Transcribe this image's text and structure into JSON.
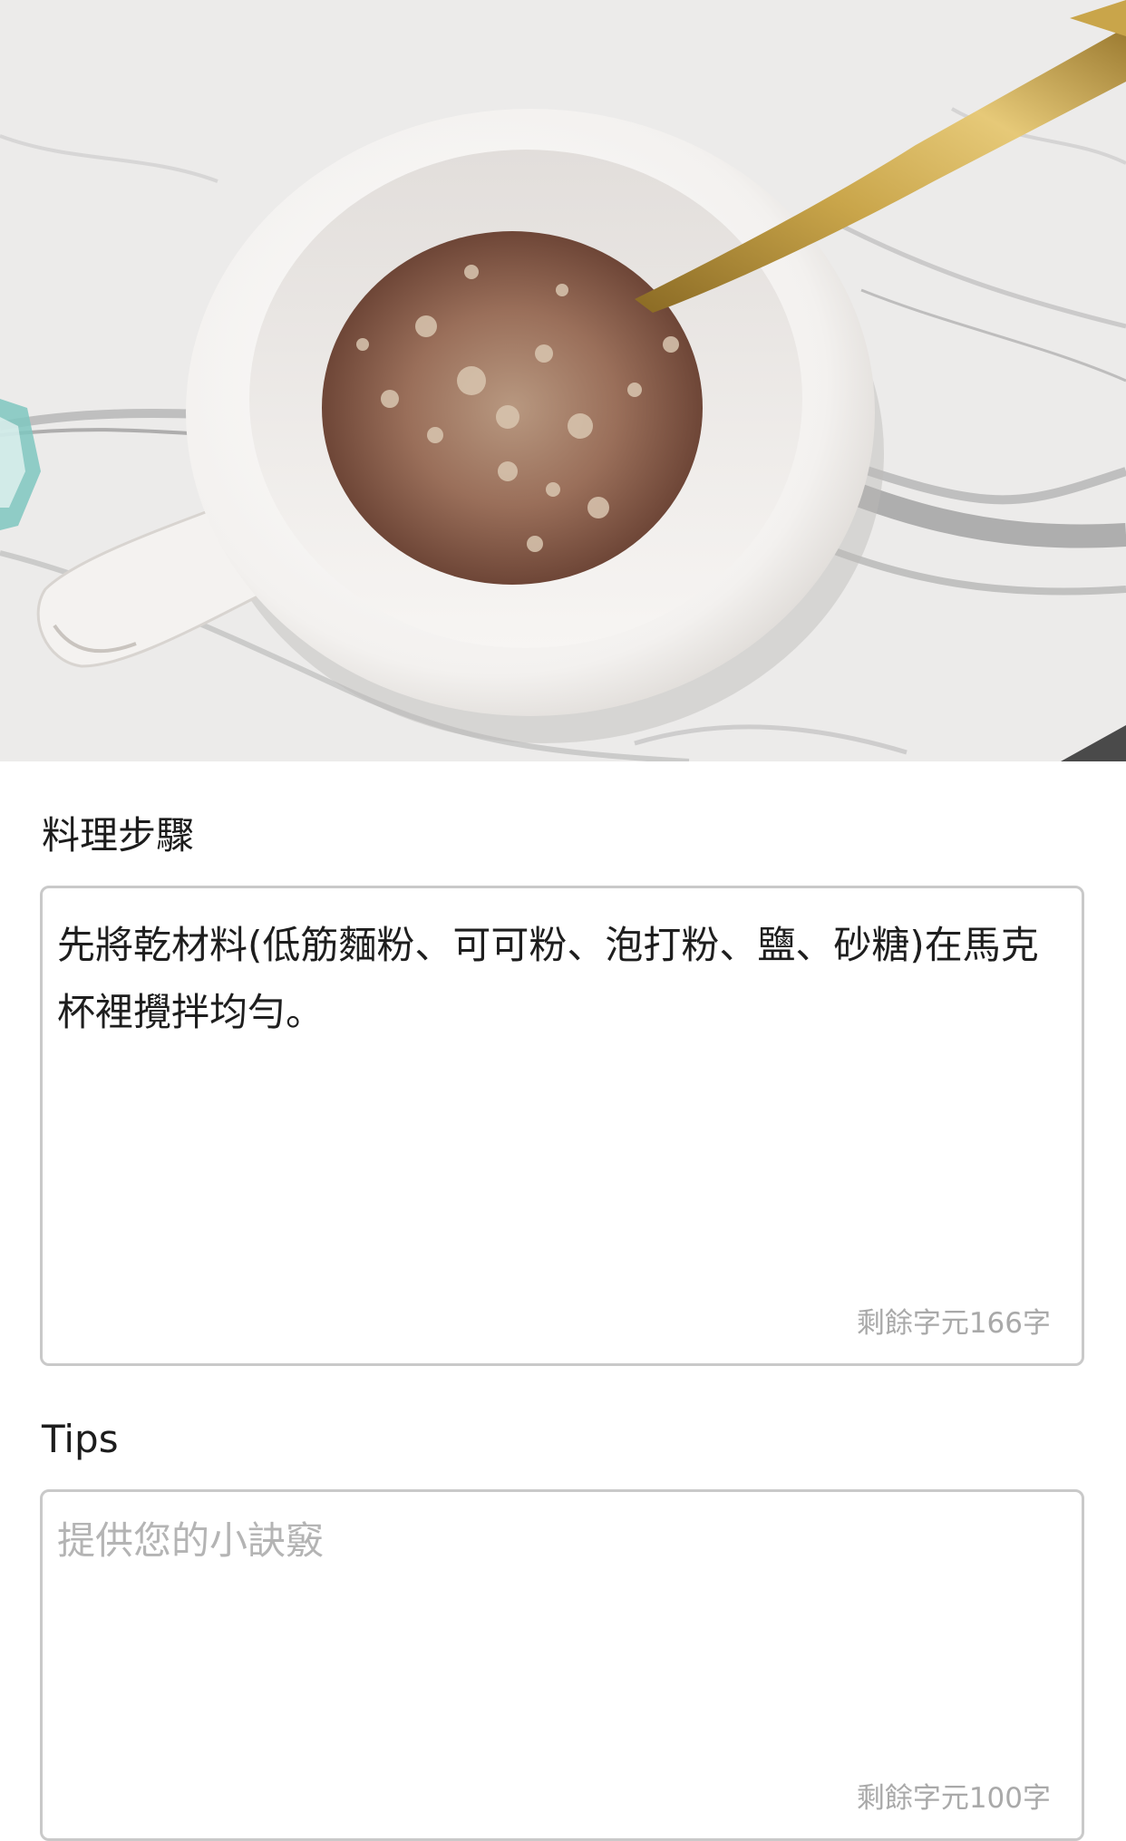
{
  "photo": {
    "description_icon": "photo-mug-cocoa"
  },
  "steps": {
    "label": "料理步驟",
    "value": "先將乾材料(低筋麵粉、可可粉、泡打粉、鹽、砂糖)在馬克杯裡攪拌均勻。",
    "counter": "剩餘字元166字"
  },
  "tips": {
    "label": "Tips",
    "placeholder": "提供您的小訣竅",
    "counter": "剩餘字元100字"
  },
  "colors": {
    "border": "#c9c9c9",
    "label_text": "#1c1c1c",
    "placeholder_text": "#b4b4b4",
    "counter_text": "#a9a9a9"
  }
}
